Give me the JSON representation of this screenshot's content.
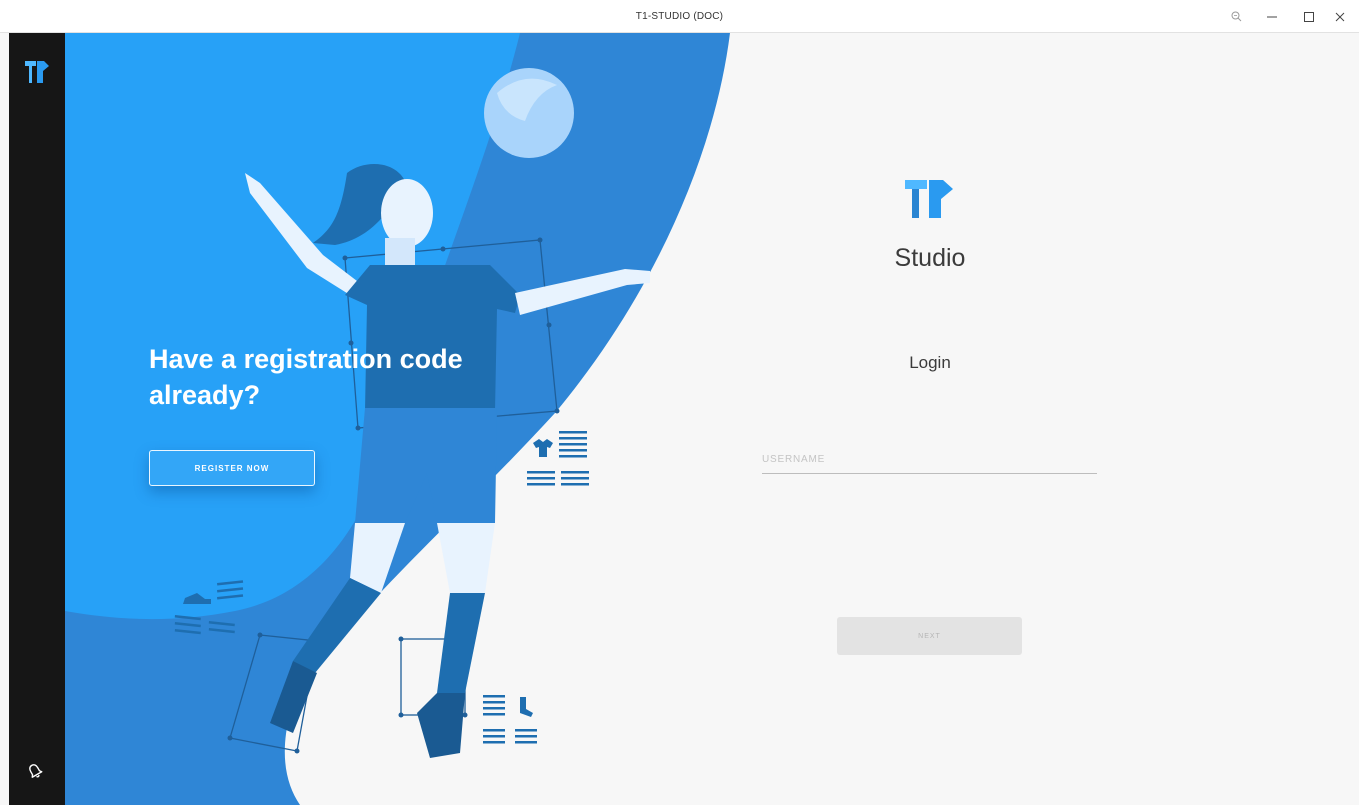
{
  "window": {
    "title": "T1-STUDIO (DOC)",
    "controls": {
      "zoom_icon": "magnifier-icon",
      "minimize_icon": "minimize-icon",
      "maximize_icon": "maximize-icon",
      "close_icon": "close-icon"
    }
  },
  "sidebar": {
    "logo_icon": "t1-logo-icon",
    "bell_icon": "bell-icon"
  },
  "hero": {
    "heading": "Have a registration code already?",
    "register_button": "REGISTER NOW"
  },
  "login": {
    "brand_name": "Studio",
    "title": "Login",
    "username_placeholder": "USERNAME",
    "username_value": "",
    "next_button": "NEXT"
  },
  "colors": {
    "accent": "#2aa0f5",
    "accent_dark": "#1e6eb0",
    "rail": "#161616",
    "panel": "#f7f7f7"
  }
}
